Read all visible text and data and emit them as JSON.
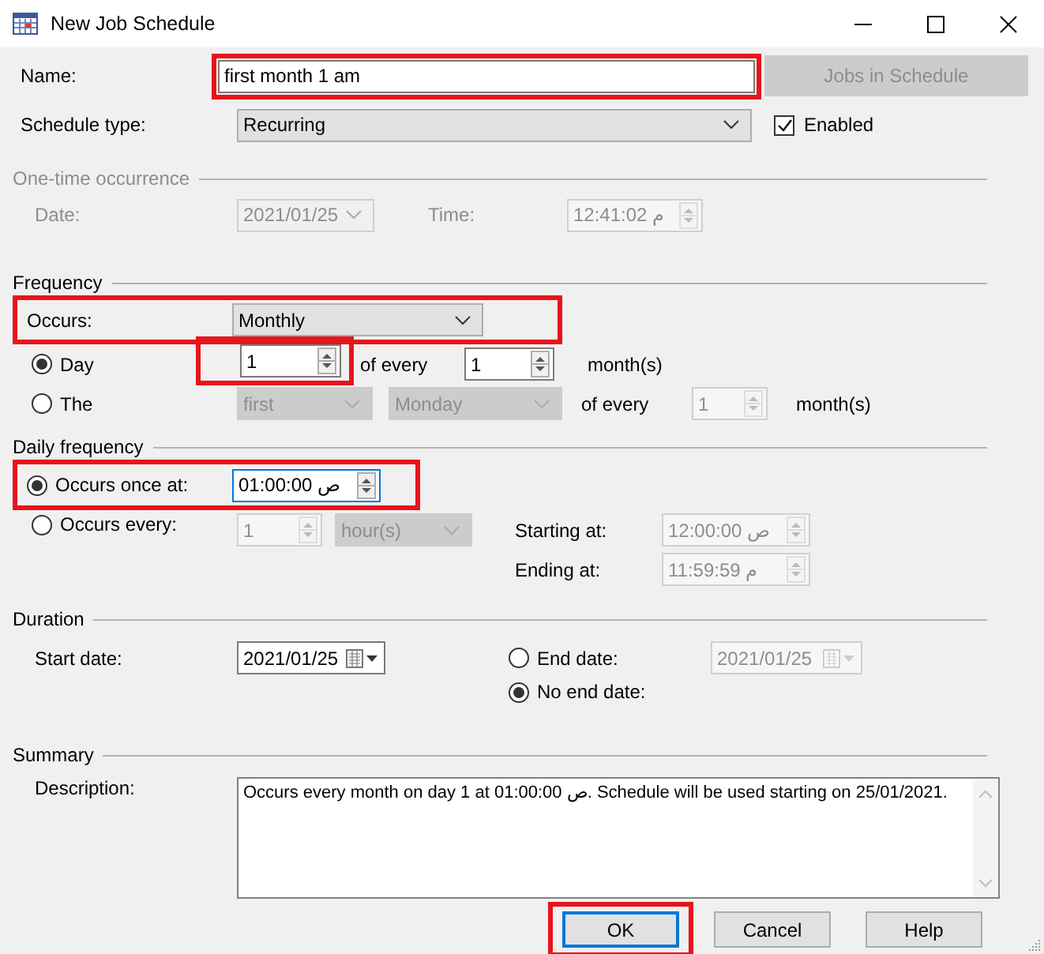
{
  "window": {
    "title": "New Job Schedule"
  },
  "name": {
    "label": "Name:",
    "value": "first month 1 am",
    "highlighted": true
  },
  "jobs_button": {
    "label": "Jobs in Schedule",
    "disabled": true
  },
  "schedule_type": {
    "label": "Schedule type:",
    "value": "Recurring"
  },
  "enabled": {
    "label": "Enabled",
    "checked": true
  },
  "one_time": {
    "title": "One-time occurrence",
    "disabled": true,
    "date_label": "Date:",
    "date": "2021/01/25",
    "time_label": "Time:",
    "time": "12:41:02 م"
  },
  "frequency": {
    "title": "Frequency",
    "occurs_label": "Occurs:",
    "occurs": "Monthly",
    "occurs_highlighted": true,
    "day_option": {
      "label": "Day",
      "selected": true,
      "day": "1",
      "day_highlighted": true,
      "of_every": "of every",
      "months": "1",
      "unit": "month(s)"
    },
    "the_option": {
      "label": "The",
      "selected": false,
      "ordinal": "first",
      "weekday": "Monday",
      "of_every": "of every",
      "months": "1",
      "unit": "month(s)"
    }
  },
  "daily_frequency": {
    "title": "Daily frequency",
    "once": {
      "label": "Occurs once at:",
      "selected": true,
      "time": "01:00:00 ص",
      "highlighted": true
    },
    "every": {
      "label": "Occurs every:",
      "selected": false,
      "interval": "1",
      "unit": "hour(s)",
      "starting_label": "Starting at:",
      "starting": "12:00:00 ص",
      "ending_label": "Ending at:",
      "ending": "11:59:59 م"
    }
  },
  "duration": {
    "title": "Duration",
    "start_label": "Start date:",
    "start": "2021/01/25",
    "end": {
      "label": "End date:",
      "selected": false,
      "date": "2021/01/25"
    },
    "no_end": {
      "label": "No end date:",
      "selected": true
    }
  },
  "summary": {
    "title": "Summary",
    "description_label": "Description:",
    "description": "Occurs every month on day 1 at 01:00:00 ص. Schedule will be used starting on 25/01/2021."
  },
  "buttons": [
    {
      "label": "OK",
      "default": true,
      "highlighted": true
    },
    {
      "label": "Cancel",
      "default": false,
      "highlighted": false
    },
    {
      "label": "Help",
      "default": false,
      "highlighted": false
    }
  ]
}
